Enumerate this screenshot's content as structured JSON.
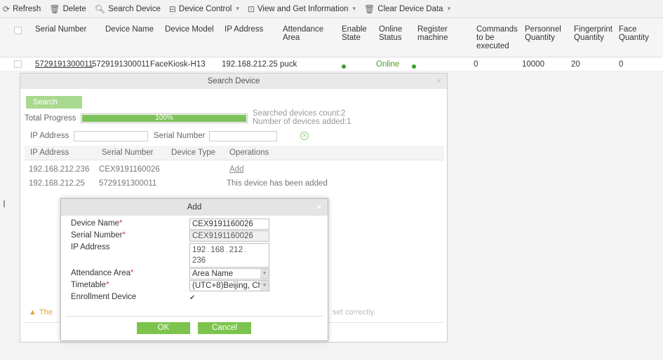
{
  "toolbar": {
    "refresh": "Refresh",
    "delete": "Delete",
    "search_device": "Search Device",
    "device_control": "Device Control",
    "view_info": "View and Get Information",
    "clear_data": "Clear Device Data"
  },
  "grid": {
    "headers": {
      "serial": "Serial Number",
      "name": "Device Name",
      "model": "Device Model",
      "ip": "IP Address",
      "area": "Attendance Area",
      "enable": "Enable State",
      "online": "Online Status",
      "register": "Register machine",
      "commands": "Commands to be executed",
      "personnel": "Personnel Quantity",
      "fingerprint": "Fingerprint Quantity",
      "face": "Face Quantity"
    },
    "row": {
      "serial": "5729191300011",
      "name": "5729191300011",
      "model": "FaceKiosk-H13",
      "ip": "192.168.212.25",
      "area": "puck",
      "online": "Online",
      "commands": "0",
      "personnel": "10000",
      "fingerprint": "20",
      "face": "0"
    }
  },
  "search_dialog": {
    "title": "Search Device",
    "close": "×",
    "search_button": "Search",
    "total_progress_label": "Total Progress",
    "progress_percent": 100,
    "progress_text": "100%",
    "searched_count": "Searched devices count:2",
    "added_count": "Number of devices added:1",
    "ip_label": "IP Address",
    "serial_label": "Serial Number",
    "columns": {
      "ip": "IP Address",
      "serial": "Serial Number",
      "type": "Device Type",
      "ops": "Operations"
    },
    "results": [
      {
        "ip": "192.168.212.236",
        "serial": "CEX9191160026",
        "type": "",
        "op": "Add"
      },
      {
        "ip": "192.168.212.25",
        "serial": "5729191300011",
        "type": "",
        "op": "This device has been added"
      }
    ],
    "warning_prefix": "The",
    "warning_suffix": "set correctly."
  },
  "add_dialog": {
    "title": "Add",
    "close": "×",
    "device_name_label": "Device Name",
    "device_name_value": "CEX9191160026",
    "serial_label": "Serial Number",
    "serial_value": "CEX9191160026",
    "ip_label": "IP Address",
    "ip_parts": [
      "192",
      "168",
      "212",
      "236"
    ],
    "area_label": "Attendance Area",
    "area_value": "Area Name",
    "timetable_label": "Timetable",
    "timetable_value": "(UTC+8)Beijing, Ch",
    "enrollment_label": "Enrollment Device",
    "enrollment_checked": true,
    "required_mark": "*",
    "ok": "OK",
    "cancel": "Cancel"
  }
}
